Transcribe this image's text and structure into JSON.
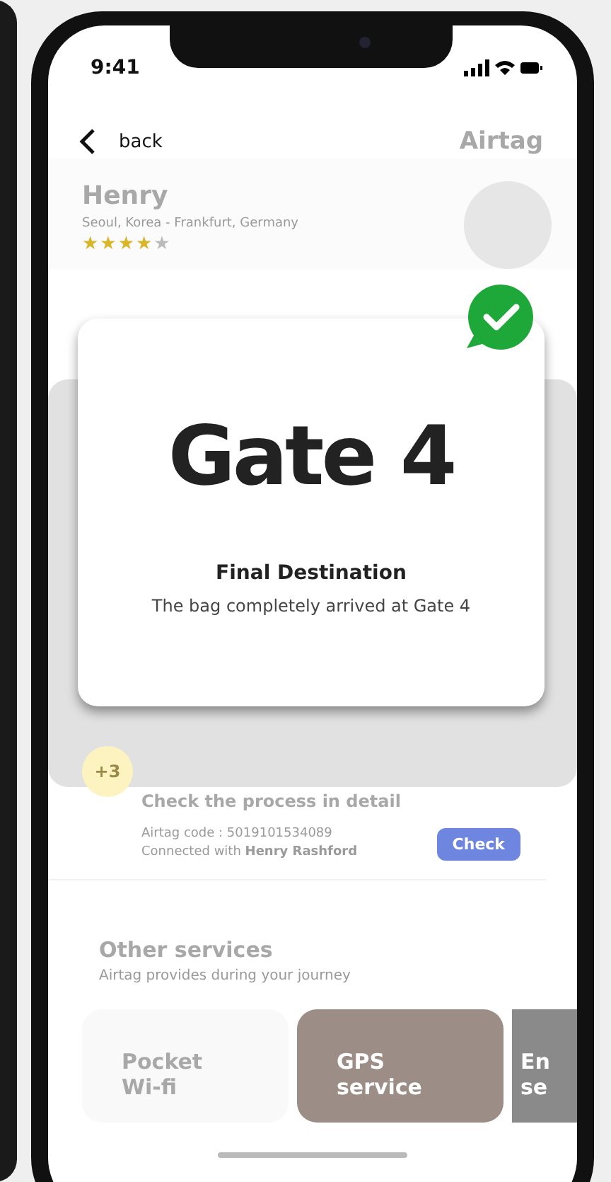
{
  "status_bar": {
    "time": "9:41"
  },
  "nav": {
    "back_label": "back",
    "title": "Airtag"
  },
  "traveler": {
    "name": "Henry",
    "route": "Seoul, Korea - Frankfurt, Germany",
    "stars": 4
  },
  "process": {
    "badge": "+3",
    "title": "Check the process in detail",
    "code": "Airtag code : 5019101534089",
    "connection": "Connected with **Henry Rashford**",
    "button": "Check"
  },
  "services": {
    "title": "Other services",
    "subtitle": "Airtag provides during your journey",
    "cards": [
      {
        "title": "Pocket Wi-fi"
      },
      {
        "title": "GPS service"
      },
      {
        "title": "En se"
      }
    ]
  },
  "modal": {
    "headline": "Gate 4",
    "title": "Final Destination",
    "message": "The bag completely arrived at Gate 4",
    "confirmed": true
  }
}
